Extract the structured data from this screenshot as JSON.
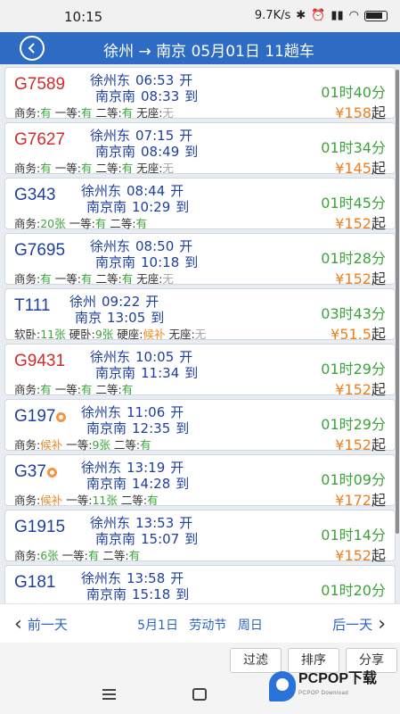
{
  "status_bar": {
    "time": "10:15",
    "network_speed": "9.7K/s"
  },
  "header": {
    "back_icon": "back-arrow-icon",
    "title": "徐州 → 南京 05月01日 11趟车"
  },
  "trains": [
    {
      "no": "G7589",
      "no_color": "#d42a2a",
      "badge": false,
      "dep_station": "徐州东",
      "dep_time": "06:53",
      "dep_word": "开",
      "arr_station": "南京南",
      "arr_time": "08:33",
      "arr_word": "到",
      "duration": "01时40分",
      "price": "¥158",
      "price_suffix": "起",
      "seats": [
        {
          "label": "商务:",
          "value": "有",
          "tone": "green"
        },
        {
          "label": "一等:",
          "value": "有",
          "tone": "green"
        },
        {
          "label": "二等:",
          "value": "有",
          "tone": "green"
        },
        {
          "label": "无座:",
          "value": "无",
          "tone": "gray"
        }
      ]
    },
    {
      "no": "G7627",
      "no_color": "#d42a2a",
      "badge": false,
      "dep_station": "徐州东",
      "dep_time": "07:15",
      "dep_word": "开",
      "arr_station": "南京南",
      "arr_time": "08:49",
      "arr_word": "到",
      "duration": "01时34分",
      "price": "¥145",
      "price_suffix": "起",
      "seats": [
        {
          "label": "商务:",
          "value": "有",
          "tone": "green"
        },
        {
          "label": "一等:",
          "value": "有",
          "tone": "green"
        },
        {
          "label": "二等:",
          "value": "有",
          "tone": "green"
        },
        {
          "label": "无座:",
          "value": "无",
          "tone": "gray"
        }
      ]
    },
    {
      "no": "G343",
      "no_color": "#1e3fa0",
      "badge": false,
      "dep_station": "徐州东",
      "dep_time": "08:44",
      "dep_word": "开",
      "arr_station": "南京南",
      "arr_time": "10:29",
      "arr_word": "到",
      "duration": "01时45分",
      "price": "¥152",
      "price_suffix": "起",
      "seats": [
        {
          "label": "商务:",
          "value": "20张",
          "tone": "green"
        },
        {
          "label": "一等:",
          "value": "有",
          "tone": "green"
        },
        {
          "label": "二等:",
          "value": "有",
          "tone": "green"
        }
      ]
    },
    {
      "no": "G7695",
      "no_color": "#1e3fa0",
      "badge": false,
      "dep_station": "徐州东",
      "dep_time": "08:50",
      "dep_word": "开",
      "arr_station": "南京南",
      "arr_time": "10:18",
      "arr_word": "到",
      "duration": "01时28分",
      "price": "¥152",
      "price_suffix": "起",
      "seats": [
        {
          "label": "商务:",
          "value": "有",
          "tone": "green"
        },
        {
          "label": "一等:",
          "value": "有",
          "tone": "green"
        },
        {
          "label": "二等:",
          "value": "有",
          "tone": "green"
        },
        {
          "label": "无座:",
          "value": "无",
          "tone": "gray"
        }
      ]
    },
    {
      "no": "T111",
      "no_color": "#1e3fa0",
      "badge": false,
      "dep_station": "徐州",
      "dep_time": "09:22",
      "dep_word": "开",
      "arr_station": "南京",
      "arr_time": "13:05",
      "arr_word": "到",
      "duration": "03时43分",
      "price": "¥51.5",
      "price_suffix": "起",
      "seats": [
        {
          "label": "软卧:",
          "value": "11张",
          "tone": "green"
        },
        {
          "label": "硬卧:",
          "value": "9张",
          "tone": "green"
        },
        {
          "label": "硬座:",
          "value": "候补",
          "tone": "orange"
        },
        {
          "label": "无座:",
          "value": "无",
          "tone": "gray"
        }
      ]
    },
    {
      "no": "G9431",
      "no_color": "#d42a2a",
      "badge": false,
      "dep_station": "徐州东",
      "dep_time": "10:05",
      "dep_word": "开",
      "arr_station": "南京南",
      "arr_time": "11:34",
      "arr_word": "到",
      "duration": "01时29分",
      "price": "¥152",
      "price_suffix": "起",
      "seats": [
        {
          "label": "商务:",
          "value": "有",
          "tone": "green"
        },
        {
          "label": "一等:",
          "value": "有",
          "tone": "green"
        },
        {
          "label": "二等:",
          "value": "有",
          "tone": "green"
        }
      ]
    },
    {
      "no": "G197",
      "no_color": "#1e3fa0",
      "badge": true,
      "dep_station": "徐州东",
      "dep_time": "11:06",
      "dep_word": "开",
      "arr_station": "南京南",
      "arr_time": "12:35",
      "arr_word": "到",
      "duration": "01时29分",
      "price": "¥152",
      "price_suffix": "起",
      "seats": [
        {
          "label": "商务:",
          "value": "候补",
          "tone": "orange"
        },
        {
          "label": "一等:",
          "value": "9张",
          "tone": "green"
        },
        {
          "label": "二等:",
          "value": "有",
          "tone": "green"
        }
      ]
    },
    {
      "no": "G37",
      "no_color": "#1e3fa0",
      "badge": true,
      "dep_station": "徐州东",
      "dep_time": "13:19",
      "dep_word": "开",
      "arr_station": "南京南",
      "arr_time": "14:28",
      "arr_word": "到",
      "duration": "01时09分",
      "price": "¥172",
      "price_suffix": "起",
      "seats": [
        {
          "label": "商务:",
          "value": "候补",
          "tone": "orange"
        },
        {
          "label": "一等:",
          "value": "11张",
          "tone": "green"
        },
        {
          "label": "二等:",
          "value": "有",
          "tone": "green"
        }
      ]
    },
    {
      "no": "G1915",
      "no_color": "#1e3fa0",
      "badge": false,
      "dep_station": "徐州东",
      "dep_time": "13:53",
      "dep_word": "开",
      "arr_station": "南京南",
      "arr_time": "15:07",
      "arr_word": "到",
      "duration": "01时14分",
      "price": "¥152",
      "price_suffix": "起",
      "seats": [
        {
          "label": "商务:",
          "value": "6张",
          "tone": "green"
        },
        {
          "label": "一等:",
          "value": "有",
          "tone": "green"
        },
        {
          "label": "二等:",
          "value": "有",
          "tone": "green"
        }
      ]
    },
    {
      "no": "G181",
      "no_color": "#1e3fa0",
      "badge": false,
      "dep_station": "徐州东",
      "dep_time": "13:58",
      "dep_word": "开",
      "arr_station": "南京南",
      "arr_time": "15:18",
      "arr_word": "到",
      "duration": "01时20分",
      "price": "",
      "price_suffix": "",
      "seats": []
    }
  ],
  "date_bar": {
    "prev": "前一天",
    "date": "5月1日",
    "holiday": "劳动节",
    "weekday": "周日",
    "next": "后一天"
  },
  "actions": {
    "filter": "过滤",
    "sort": "排序",
    "share": "分享"
  },
  "watermark": {
    "text": "PCPOP下载",
    "sub": "PCPOP Download"
  },
  "colors": {
    "header_bg": "#2e6cc4",
    "green": "#3ca33c",
    "orange": "#f08a24",
    "red": "#d42a2a",
    "blue": "#1e3fa0"
  }
}
